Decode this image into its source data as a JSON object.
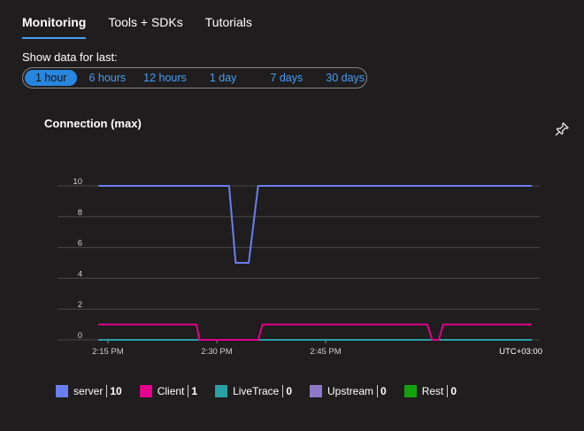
{
  "tabs": [
    {
      "label": "Monitoring",
      "active": true
    },
    {
      "label": "Tools + SDKs",
      "active": false
    },
    {
      "label": "Tutorials",
      "active": false
    }
  ],
  "range": {
    "label": "Show data for last:",
    "options": [
      "1 hour",
      "6 hours",
      "12 hours",
      "1 day",
      "7 days",
      "30 days"
    ],
    "selected": "1 hour"
  },
  "chart": {
    "title": "Connection (max)",
    "pin_icon": "pin-icon"
  },
  "colors": {
    "server": "#6b7ef0",
    "Client": "#e3008c",
    "LiveTrace": "#2aa0a4",
    "Upstream": "#8e79c8",
    "Rest": "#13a10e",
    "accent": "#479ef5",
    "grid": "#4a4848"
  },
  "chart_data": {
    "type": "line",
    "title": "Connection (max)",
    "ylim": [
      0,
      10
    ],
    "yticks": [
      "0",
      "2",
      "4",
      "6",
      "8",
      "10"
    ],
    "xticks": [
      {
        "label": "2:15 PM",
        "t": 0.0
      },
      {
        "label": "2:30 PM",
        "t": 15.0
      },
      {
        "label": "2:45 PM",
        "t": 30.0
      }
    ],
    "timezone_label": "UTC+03:00",
    "grid": true,
    "legend_position": "bottom",
    "series": [
      {
        "name": "server",
        "x": [
          -1.3,
          16.7,
          17.6,
          19.4,
          20.7,
          58.4
        ],
        "y": [
          10,
          10,
          5,
          5,
          10,
          10
        ]
      },
      {
        "name": "Client",
        "x": [
          -1.3,
          12.2,
          12.6,
          16.7,
          20.7,
          21.3,
          44.0,
          44.7,
          45.6,
          46.2,
          58.4
        ],
        "y": [
          1,
          1,
          0,
          0,
          0,
          1,
          1,
          0,
          0,
          1,
          1
        ]
      },
      {
        "name": "LiveTrace",
        "x": [
          -1.3,
          58.4
        ],
        "y": [
          0,
          0
        ]
      },
      {
        "name": "Upstream",
        "x": [
          -1.3,
          58.4
        ],
        "y": [
          0,
          0
        ]
      },
      {
        "name": "Rest",
        "x": [
          -1.3,
          58.4
        ],
        "y": [
          0,
          0
        ]
      }
    ]
  },
  "legend": [
    {
      "name": "server",
      "value": "10"
    },
    {
      "name": "Client",
      "value": "1"
    },
    {
      "name": "LiveTrace",
      "value": "0"
    },
    {
      "name": "Upstream",
      "value": "0"
    },
    {
      "name": "Rest",
      "value": "0"
    }
  ]
}
